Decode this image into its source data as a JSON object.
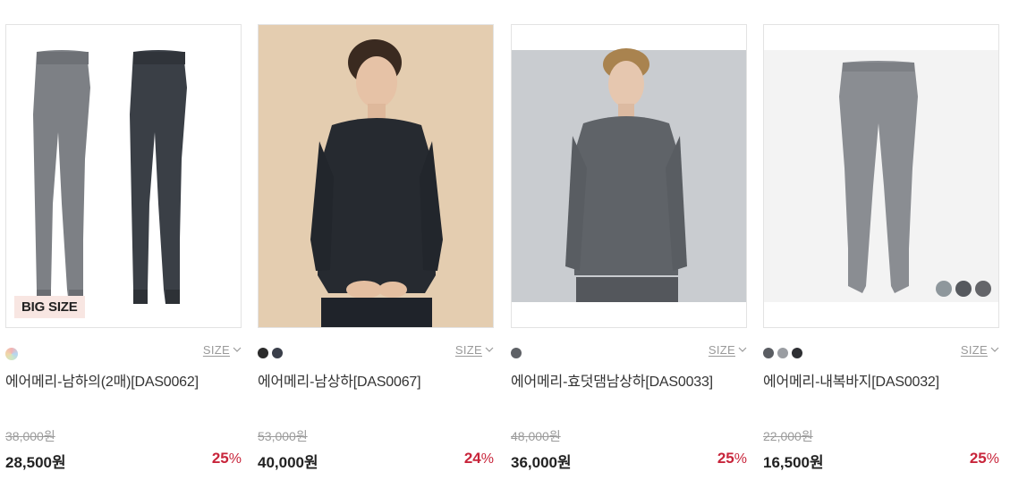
{
  "size_label": "SIZE",
  "products": [
    {
      "badge": "BIG SIZE",
      "swatches": [
        "multi"
      ],
      "name": "에어메리-남하의(2매)[DAS0062]",
      "original_price": "38,000원",
      "price": "28,500원",
      "discount_value": "25",
      "discount_unit": "%"
    },
    {
      "swatches": [
        "#2b2b2b",
        "#3a3f4a"
      ],
      "name": "에어메리-남상하[DAS0067]",
      "original_price": "53,000원",
      "price": "40,000원",
      "discount_value": "24",
      "discount_unit": "%"
    },
    {
      "swatches": [
        "#5e6166"
      ],
      "name": "에어메리-효덧댐남상하[DAS0033]",
      "original_price": "48,000원",
      "price": "36,000원",
      "discount_value": "25",
      "discount_unit": "%"
    },
    {
      "swatches": [
        "#5a5d62",
        "#9a9da2",
        "#2e2f33"
      ],
      "overlay_colors": [
        "#8e979c",
        "#56595e",
        "#646569"
      ],
      "name": "에어메리-내복바지[DAS0032]",
      "original_price": "22,000원",
      "price": "16,500원",
      "discount_value": "25",
      "discount_unit": "%"
    }
  ],
  "colors": {
    "accent_discount": "#c8253b",
    "muted": "#9b9b9b"
  }
}
